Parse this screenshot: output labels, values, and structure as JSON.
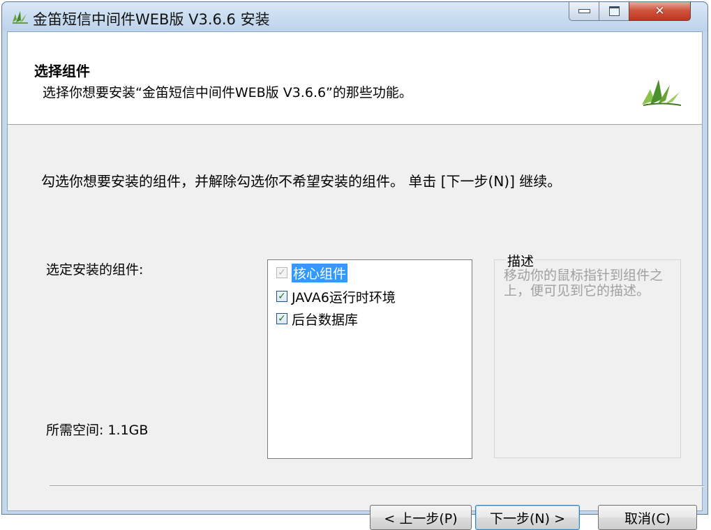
{
  "window": {
    "title": "金笛短信中间件WEB版 V3.6.6 安装",
    "icon": "leaf-icon",
    "controls": {
      "minimize": "minimize-icon",
      "maximize": "maximize-icon",
      "close": "✕"
    }
  },
  "header": {
    "title": "选择组件",
    "subtitle": "选择你想要安装“金笛短信中间件WEB版 V3.6.6”的那些功能。",
    "logo": "leaf-logo"
  },
  "instructions": "勾选你想要安装的组件，并解除勾选你不希望安装的组件。 单击 [下一步(N)] 继续。",
  "components_label": "选定安装的组件:",
  "space_required": "所需空间: 1.1GB",
  "components": [
    {
      "label": "核心组件",
      "checked": true,
      "disabled": true,
      "selected": true
    },
    {
      "label": "JAVA6运行时环境",
      "checked": true,
      "disabled": false,
      "selected": false
    },
    {
      "label": "后台数据库",
      "checked": true,
      "disabled": false,
      "selected": false
    }
  ],
  "description": {
    "title": "描述",
    "text": "移动你的鼠标指针到组件之上，便可见到它的描述。"
  },
  "buttons": {
    "back": "< 上一步(P)",
    "next": "下一步(N) >",
    "cancel": "取消(C)"
  },
  "colors": {
    "selection": "#3399ff",
    "titlebar": "#c9dcf0",
    "close_button": "#c94a34"
  }
}
